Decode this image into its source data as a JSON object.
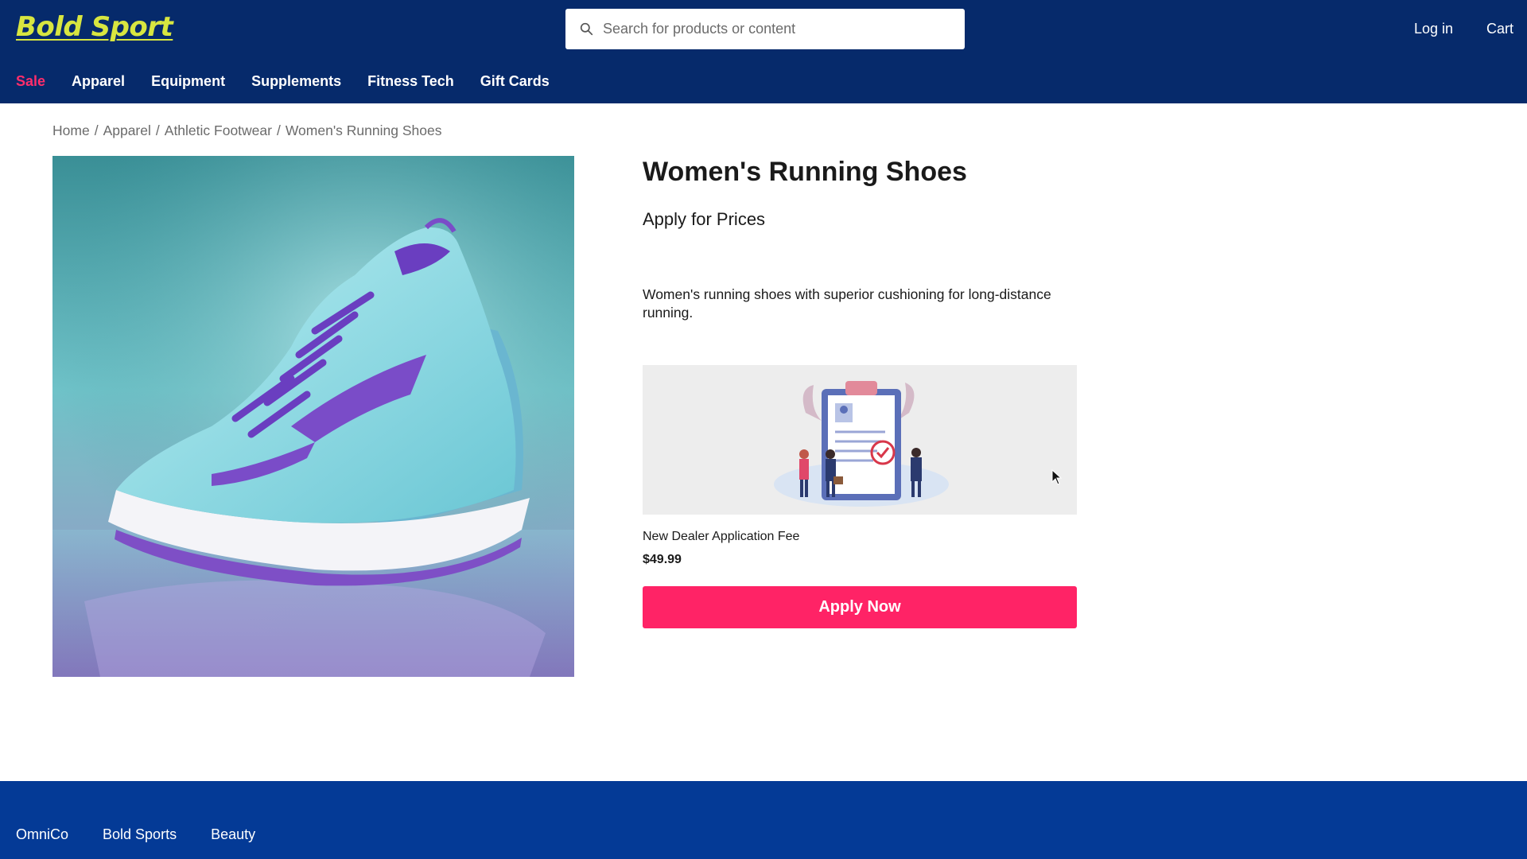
{
  "header": {
    "logo": "Bold Sport",
    "search": {
      "placeholder": "Search for products or content"
    },
    "login": "Log in",
    "cart": "Cart"
  },
  "nav": [
    "Sale",
    "Apparel",
    "Equipment",
    "Supplements",
    "Fitness Tech",
    "Gift Cards"
  ],
  "breadcrumb": [
    "Home",
    "Apparel",
    "Athletic Footwear",
    "Women's Running Shoes"
  ],
  "product": {
    "title": "Women's Running Shoes",
    "subtitle": "Apply for Prices",
    "description": "Women's running shoes with superior cushioning for long-distance running."
  },
  "fee": {
    "name": "New Dealer Application Fee",
    "price": "$49.99",
    "button": "Apply Now"
  },
  "footer": [
    "OmniCo",
    "Bold Sports",
    "Beauty"
  ],
  "colors": {
    "header_bg": "#062a6b",
    "footer_bg": "#043a96",
    "logo": "#d8e640",
    "accent": "#ff2366",
    "sale": "#ff2d6b"
  }
}
